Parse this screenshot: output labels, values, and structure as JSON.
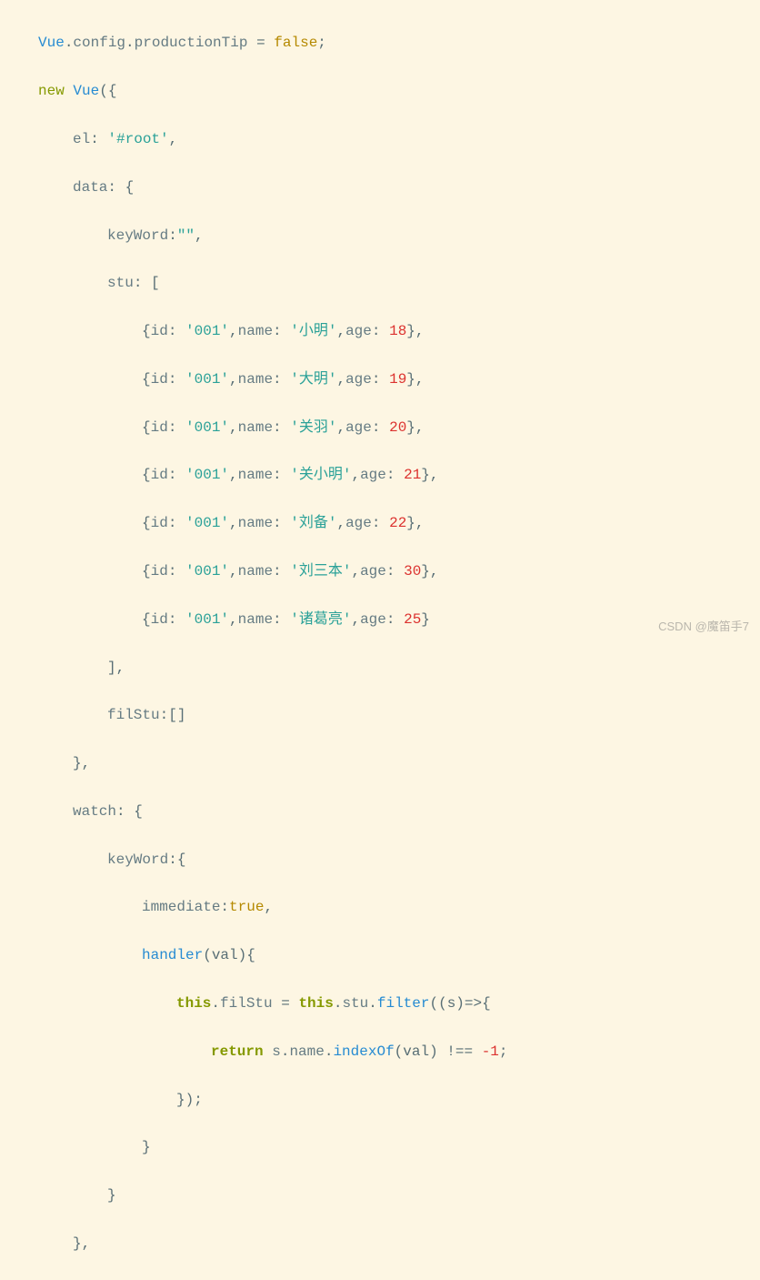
{
  "code": {
    "line1_vue": "Vue",
    "line1_dot1": ".",
    "line1_config": "config",
    "line1_dot2": ".",
    "line1_proptip": "productionTip",
    "line1_eq": " = ",
    "line1_false": "false",
    "line1_semi": ";",
    "line2_new": "new",
    "line2_sp": " ",
    "line2_vue": "Vue",
    "line2_paren": "({",
    "line3_el": "el",
    "line3_colon": ": ",
    "line3_root": "'#root'",
    "line3_comma": ",",
    "line4_data": "data",
    "line4_rest": ": {",
    "line5_kw": "keyWord",
    "line5_colon": ":",
    "line5_empty": "\"\"",
    "line5_comma": ",",
    "line6_stu": "stu",
    "line6_rest": ": [",
    "stu_open": "{",
    "stu_id": "id",
    "stu_colon": ": ",
    "stu_idval": "'001'",
    "stu_comma1": ",",
    "stu_name": "name",
    "stu_nameval1": "'小明'",
    "stu_nameval2": "'大明'",
    "stu_nameval3": "'关羽'",
    "stu_nameval4": "'关小明'",
    "stu_nameval5": "'刘备'",
    "stu_nameval6": "'刘三本'",
    "stu_nameval7": "'诸葛亮'",
    "stu_age": "age",
    "stu_ageval1": "18",
    "stu_ageval2": "19",
    "stu_ageval3": "20",
    "stu_ageval4": "21",
    "stu_ageval5": "22",
    "stu_ageval6": "30",
    "stu_ageval7": "25",
    "stu_close": "},",
    "stu_close_last": "}",
    "line14_close": "],",
    "line15_filstu": "filStu",
    "line15_val": ":[]",
    "line16_close": "},",
    "line17_watch": "watch",
    "line17_rest": ": {",
    "line18_kw": "keyWord",
    "line18_rest": ":{",
    "line19_imm": "immediate",
    "line19_colon": ":",
    "line19_true": "true",
    "line19_comma": ",",
    "line20_handler": "handler",
    "line20_val": "(val){",
    "line21_this": "this",
    "line21_dot": ".",
    "line21_filstu": "filStu",
    "line21_eq": " = ",
    "line21_this2": "this",
    "line21_stu": "stu",
    "line21_filter": "filter",
    "line21_arrow": "((s)=>{",
    "line22_return": "return",
    "line22_sp": " ",
    "line22_s": "s",
    "line22_name": "name",
    "line22_indexof": "indexOf",
    "line22_val": "(val) !== ",
    "line22_neg1": "-1",
    "line22_semi": ";",
    "line23": "});",
    "line24": "}",
    "line25": "}",
    "line26": "},"
  },
  "watermark": "CSDN @魔笛手7"
}
